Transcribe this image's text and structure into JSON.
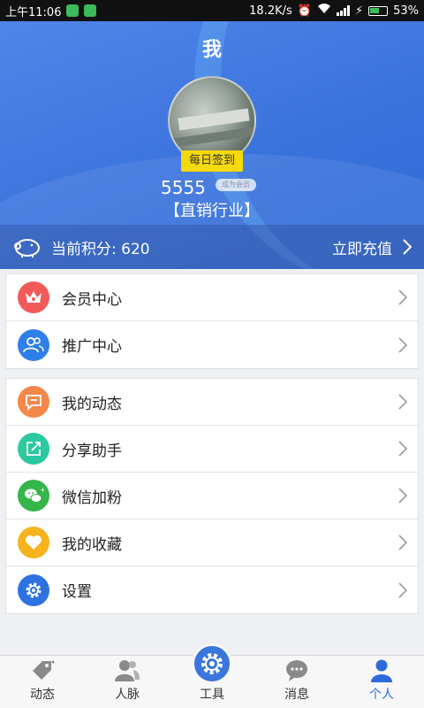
{
  "status_bar": {
    "time": "上午11:06",
    "speed": "18.2K/s",
    "battery": "53%"
  },
  "header": {
    "title": "我",
    "signin_label": "每日签到",
    "username": "5555",
    "member_badge": "成为会员",
    "industry": "【直销行业】",
    "points_text": "当前积分: 620",
    "recharge_label": "立即充值"
  },
  "menu_group_1": [
    {
      "label": "会员中心",
      "icon": "crown-icon",
      "color": "#f25a5a"
    },
    {
      "label": "推广中心",
      "icon": "people-icon",
      "color": "#2f7fe8"
    }
  ],
  "menu_group_2": [
    {
      "label": "我的动态",
      "icon": "chat-bubble-icon",
      "color": "#f4884a"
    },
    {
      "label": "分享助手",
      "icon": "share-icon",
      "color": "#2cc8a0"
    },
    {
      "label": "微信加粉",
      "icon": "wechat-icon",
      "color": "#35b54a"
    },
    {
      "label": "我的收藏",
      "icon": "heart-icon",
      "color": "#f6b31d"
    },
    {
      "label": "设置",
      "icon": "gear-icon",
      "color": "#2d72e0"
    }
  ],
  "bottom_nav": [
    {
      "label": "动态",
      "icon": "tag-icon"
    },
    {
      "label": "人脉",
      "icon": "contacts-icon"
    },
    {
      "label": "工具",
      "icon": "gear-icon"
    },
    {
      "label": "消息",
      "icon": "message-icon"
    },
    {
      "label": "个人",
      "icon": "person-icon",
      "active": true
    }
  ]
}
